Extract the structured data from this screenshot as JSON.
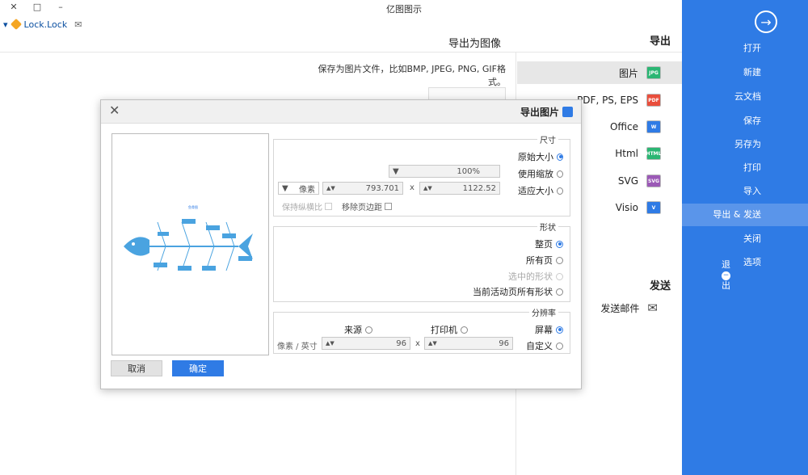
{
  "window": {
    "title": "亿图图示",
    "min": "–",
    "max": "□",
    "close": "✕"
  },
  "userbar": {
    "label": "Lock.Lock"
  },
  "sidebar": {
    "items": [
      {
        "label": "打开"
      },
      {
        "label": "新建"
      },
      {
        "label": "云文档"
      },
      {
        "label": "保存"
      },
      {
        "label": "另存为"
      },
      {
        "label": "打印"
      },
      {
        "label": "导入"
      },
      {
        "label": "导出 & 发送"
      },
      {
        "label": "关闭"
      },
      {
        "label": "选项"
      },
      {
        "label": "退出"
      }
    ],
    "active": "导出 & 发送"
  },
  "export": {
    "heading": "导出",
    "formats": [
      {
        "label": "图片",
        "icon_text": "JPG",
        "color": "#2bb673"
      },
      {
        "label": "PDF, PS, EPS",
        "icon_text": "PDF",
        "color": "#e94e3c"
      },
      {
        "label": "Office",
        "icon_text": "W",
        "color": "#2f7be5"
      },
      {
        "label": "Html",
        "icon_text": "HTML",
        "color": "#2bb673"
      },
      {
        "label": "SVG",
        "icon_text": "SVG",
        "color": "#9b59b6"
      },
      {
        "label": "Visio",
        "icon_text": "V",
        "color": "#2f7be5"
      }
    ],
    "send_heading": "发送",
    "send_mail": "发送邮件"
  },
  "content": {
    "title": "导出为图像",
    "desc": "保存为图片文件，比如BMP, JPEG, PNG, GIF格式。"
  },
  "dialog": {
    "title": "导出图片",
    "size_group": "尺寸",
    "opt_original": "原始大小",
    "opt_scale": "使用缩放",
    "scale_value": "100%",
    "opt_fit": "适应大小",
    "width": "1122.52",
    "height": "793.701",
    "times": "x",
    "unit": "像素",
    "keep_ratio": "保持纵横比",
    "remove_margin": "移除页边距",
    "shape_group": "形状",
    "opt_page": "整页",
    "opt_all": "所有页",
    "opt_selected": "选中的形状",
    "opt_current_all": "当前活动页所有形状",
    "res_group": "分辨率",
    "opt_screen": "屏幕",
    "opt_printer": "打印机",
    "opt_source": "来源",
    "opt_custom": "自定义",
    "dpi_x": "96",
    "dpi_y": "96",
    "dpi_unit": "像素 / 英寸",
    "ok": "确定",
    "cancel": "取消",
    "preview_title": "鱼骨图"
  },
  "colors": {
    "accent": "#2f7be5"
  }
}
